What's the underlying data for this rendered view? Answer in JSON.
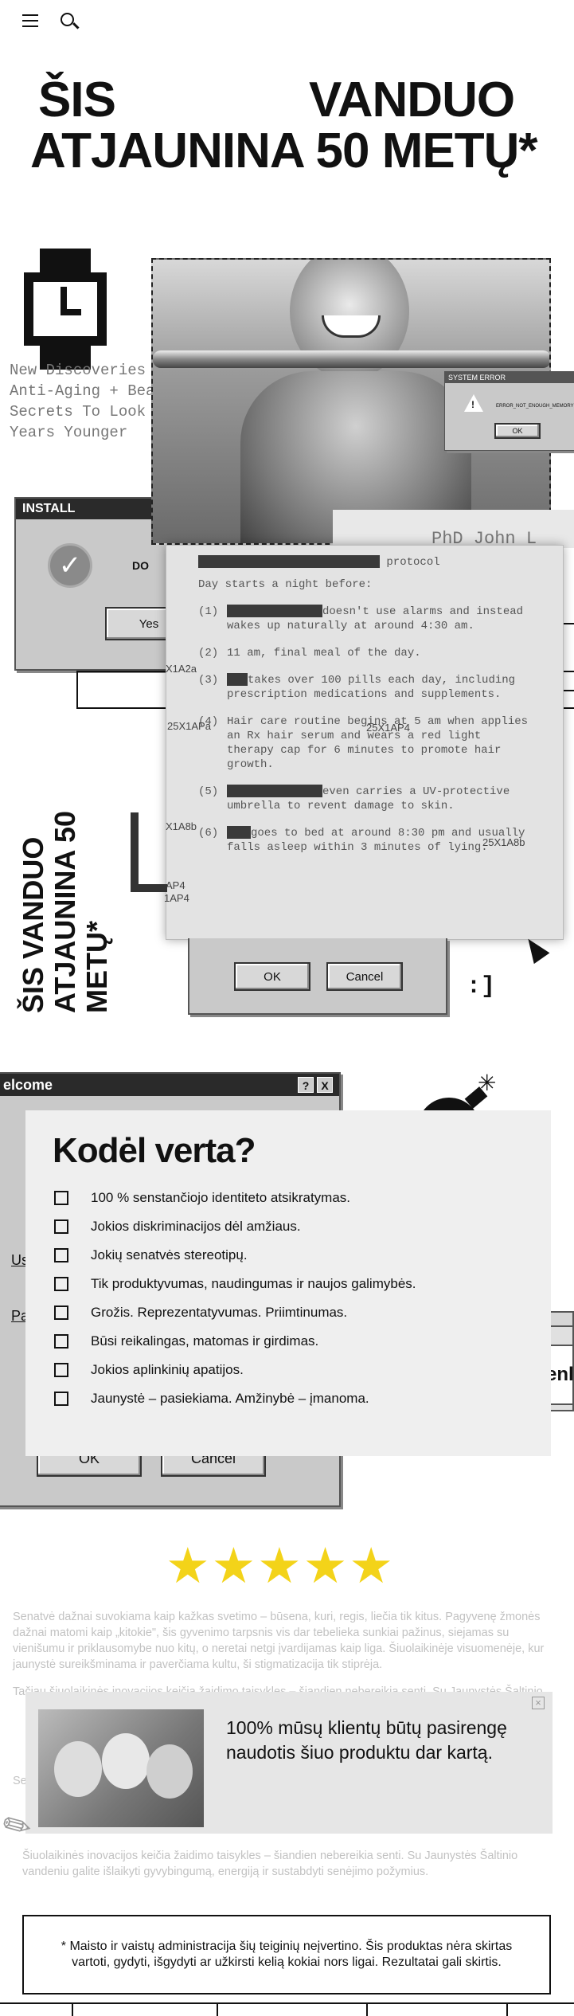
{
  "header": {
    "menu_icon": "hamburger-icon",
    "search_icon": "search-icon"
  },
  "hero": {
    "title_word1": "ŠIS",
    "title_word2": "VANDUO",
    "title_line2": "ATJAUNINA 50 METŲ*"
  },
  "intro_lines": [
    "New Discoveries In",
    "Anti-Aging + Beaut",
    "Secrets To Look &",
    "Years Younger"
  ],
  "system_error": {
    "title": "SYSTEM ERROR",
    "message": "ERROR_NOT_ENOUGH_MEMORY",
    "ok": "OK"
  },
  "install_dialog": {
    "title": "INSTALL",
    "text": "DO",
    "yes": "Yes"
  },
  "phd_label": "PhD John L",
  "protocol": {
    "heading": "protocol",
    "subheading": "Day starts a night before:",
    "steps": [
      {
        "num": "(1)",
        "text": "doesn't use alarms and instead wakes up  naturally at around 4:30 am."
      },
      {
        "num": "(2)",
        "text": "11 am, final meal of the day."
      },
      {
        "num": "(3)",
        "text": "takes over 100 pills each day, including prescription medications and supplements."
      },
      {
        "num": "(4)",
        "text": "Hair care routine begins at 5 am when applies an Rx hair serum and wears a red light therapy cap for 6 minutes to promote hair growth."
      },
      {
        "num": "(5)",
        "text": "even carries a UV-protective umbrella to revent damage to skin."
      },
      {
        "num": "(6)",
        "text": "goes to bed at around 8:30 pm and usually falls asleep within 3 minutes of lying."
      }
    ],
    "side_codes": [
      "X1A2a",
      "25X1APa",
      "25X1AP4",
      "X1A8b",
      "25X1A8b",
      "AP4",
      "1AP4"
    ]
  },
  "ok_cancel": {
    "ok": "OK",
    "cancel": "Cancel"
  },
  "vertical_title": "ŠIS VANDUO ATJAUNINA 50 METŲ*",
  "welcome": {
    "title": "elcome",
    "help": "?",
    "close": "X",
    "ok": "OK",
    "cancel": "Cancel",
    "field1": "Us",
    "field2": "Pa"
  },
  "kodel": {
    "title": "Kodėl verta?",
    "items": [
      "100 % senstančiojo identiteto atsikratymas.",
      "Jokios diskriminacijos dėl amžiaus.",
      "Jokių senatvės stereotipų.",
      "Tik produktyvumas, naudingumas ir naujos galimybės.",
      "Grožis. Reprezentatyvumas. Priimtinumas.",
      "Būsi reikalingas, matomas ir girdimas.",
      "Jokios aplinkinių apatijos.",
      "Jaunystė – pasiekiama. Amžinybė – įmanoma."
    ]
  },
  "nesen_label": "Nesenl",
  "stars": "★★★★★",
  "body_text": {
    "p1": "Senatvė dažnai suvokiama kaip kažkas svetimo – būsena, kuri, regis, liečia tik kitus. Pagyvenę žmonės dažnai matomi kaip „kitokie\", šis gyvenimo tarpsnis vis dar tebelieka sunkiai pažinus, siejamas su vienišumu ir priklausomybe nuo kitų, o neretai netgi įvardijamas kaip liga. Šiuolaikinėje visuomenėje, kur jaunystė sureikšminama ir paverčiama kultu, ši stigmatizacija tik stiprėja.",
    "p2_start": "Tačiau šiuolaikinės inovacijos keičia žaidimo taisykles – šiandien nebereikia senti. Su Jaunystės Šaltinio",
    "p3_start": "Se",
    "p4": "Šiuolaikinės inovacijos keičia žaidimo taisykles – šiandien nebereikia senti. Su Jaunystės Šaltinio vandeniu galite išlaikyti gyvybingumą, energiją ir sustabdyti senėjimo požymius."
  },
  "testimonial": {
    "text": "100% mūsų klientų būtų pasirengę naudotis šiuo produktu dar kartą.",
    "close": "×"
  },
  "disclaimer": "* Maisto ir vaistų administracija šių teiginių neįvertino. Šis produktas  nėra skirtas vartoti, gydyti, išgydyti ar užkirsti kelią kokiai nors ligai. Rezultatai gali skirtis."
}
